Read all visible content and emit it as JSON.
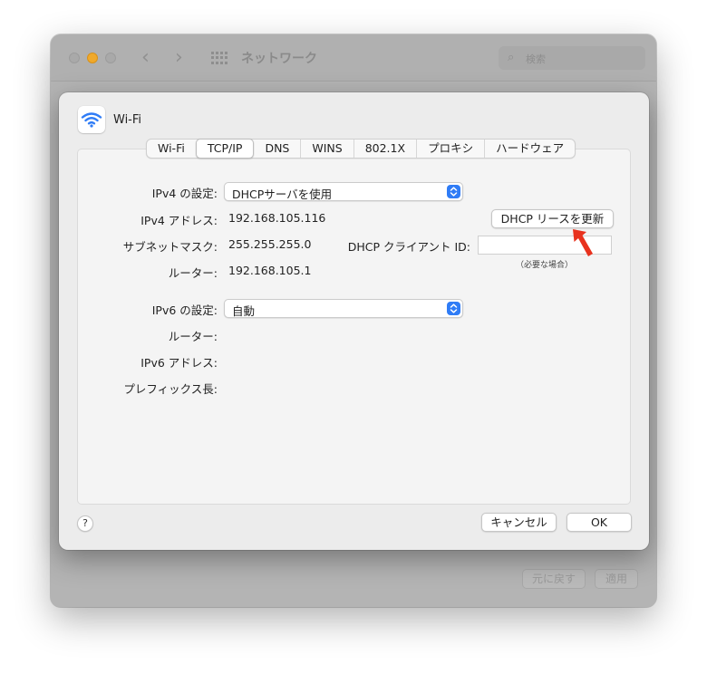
{
  "window": {
    "title": "ネットワーク",
    "search_placeholder": "検索",
    "revert_label": "元に戻す",
    "apply_label": "適用"
  },
  "sheet": {
    "service_name": "Wi-Fi",
    "tabs": [
      {
        "label": "Wi-Fi",
        "selected": false
      },
      {
        "label": "TCP/IP",
        "selected": true
      },
      {
        "label": "DNS",
        "selected": false
      },
      {
        "label": "WINS",
        "selected": false
      },
      {
        "label": "802.1X",
        "selected": false
      },
      {
        "label": "プロキシ",
        "selected": false
      },
      {
        "label": "ハードウェア",
        "selected": false
      }
    ],
    "ipv4": {
      "config_label": "IPv4 の設定:",
      "config_value": "DHCPサーバを使用",
      "address_label": "IPv4 アドレス:",
      "address_value": "192.168.105.116",
      "subnet_label": "サブネットマスク:",
      "subnet_value": "255.255.255.0",
      "router_label": "ルーター:",
      "router_value": "192.168.105.1",
      "renew_button": "DHCP リースを更新",
      "client_id_label": "DHCP クライアント ID:",
      "client_id_value": "",
      "client_id_note": "（必要な場合）"
    },
    "ipv6": {
      "config_label": "IPv6 の設定:",
      "config_value": "自動",
      "router_label": "ルーター:",
      "address_label": "IPv6 アドレス:",
      "prefix_label": "プレフィックス長:"
    },
    "help_label": "?",
    "cancel_button": "キャンセル",
    "ok_button": "OK"
  },
  "colors": {
    "accent": "#2f7cf6",
    "annotation_arrow": "#e8321e",
    "minimize": "#f0a92b"
  }
}
